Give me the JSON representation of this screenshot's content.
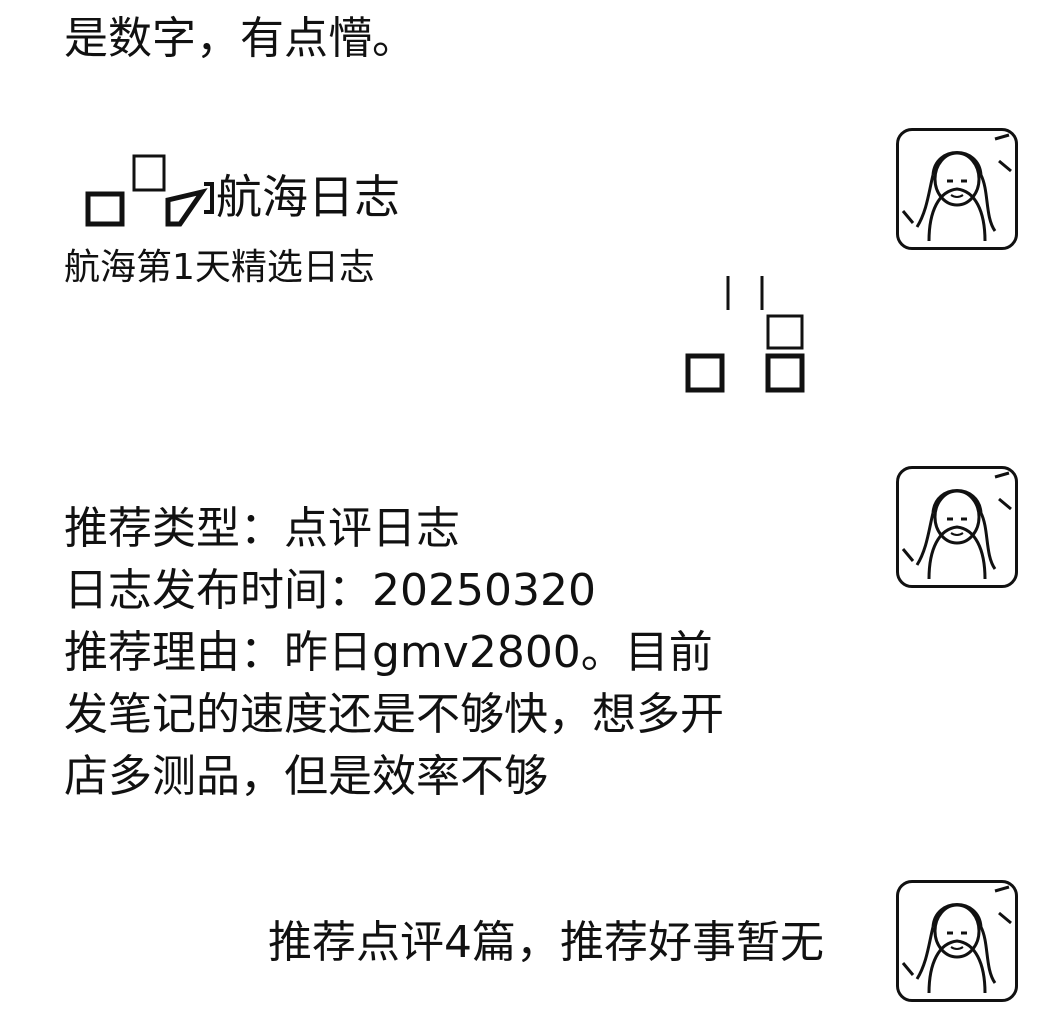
{
  "messages": {
    "top_partial": "是数字，有点懵。",
    "card": {
      "title": "航海日志",
      "subtitle": "航海第1天精选日志",
      "icon": "journal-icon"
    },
    "attachment_glyph": "file-glyph-icon",
    "recommendation": {
      "line1": "推荐类型：点评日志",
      "line2": "日志发布时间：20250320",
      "line3": "推荐理由：昨日gmv2800。目前",
      "line4": "发笔记的速度还是不够快，想多开",
      "line5": "店多测品，但是效率不够"
    },
    "summary": "推荐点评4篇，推荐好事暂无"
  },
  "avatars": {
    "icon": "user-avatar-icon"
  }
}
